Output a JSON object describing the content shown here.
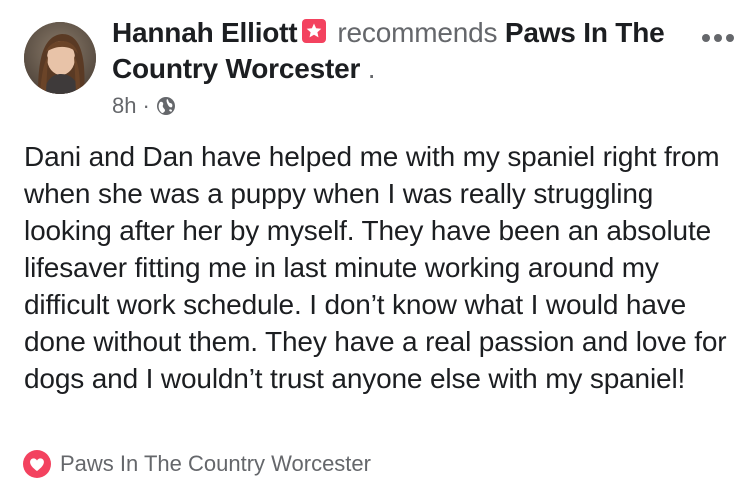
{
  "post": {
    "author_name": "Hannah Elliott",
    "action_text": "recommends",
    "page_name": "Paws In The Country Worcester",
    "trailing": ".",
    "time": "8h",
    "separator": "·",
    "privacy_icon": "globe-icon",
    "badge_icon": "star-badge-icon",
    "more_icon": "more-options-icon",
    "body": "Dani and Dan have helped me with my spaniel right from when she was a puppy when I was really struggling looking after her by myself. They have been an absolute lifesaver fitting me in last minute working around my difficult work schedule. I don’t know what I would have done without them. They have a real passion and love for dogs and I wouldn’t trust anyone else with my spaniel!",
    "footer_icon": "recommendation-heart-icon",
    "footer_page": "Paws In The Country Worcester"
  },
  "colors": {
    "text_primary": "#1c1e21",
    "text_secondary": "#65676b",
    "badge": "#f3425f",
    "recommend": "#f3425f"
  }
}
